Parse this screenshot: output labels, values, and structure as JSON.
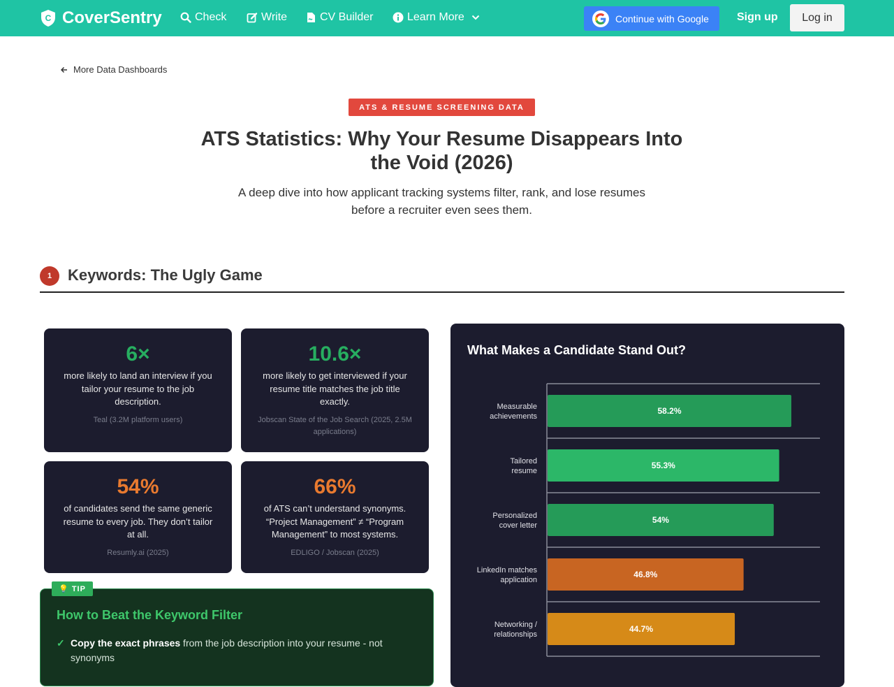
{
  "nav": {
    "brand": "CoverSentry",
    "links": [
      {
        "label": "Check",
        "icon": "search-icon"
      },
      {
        "label": "Write",
        "icon": "edit-icon"
      },
      {
        "label": "CV Builder",
        "icon": "file-signature-icon"
      },
      {
        "label": "Learn More",
        "icon": "info-circle-icon"
      }
    ],
    "google_label": "Continue with Google",
    "signup_label": "Sign up",
    "login_label": "Log in"
  },
  "header": {
    "back_label": "More Data Dashboards",
    "badge": "ATS & RESUME SCREENING DATA",
    "title": "ATS Statistics: Why Your Resume Disappears Into the Void (2026)",
    "subtitle": "A deep dive into how applicant tracking systems filter, rank, and lose resumes before a recruiter even sees them."
  },
  "section": {
    "number": "1",
    "title": "Keywords: The Ugly Game"
  },
  "stats": [
    {
      "value": "6×",
      "desc": "more likely to land an interview if you tailor your resume to the job description.",
      "source": "Teal (3.2M platform users)",
      "color": "#27ae60"
    },
    {
      "value": "10.6×",
      "desc": "more likely to get interviewed if your resume title matches the job title exactly.",
      "source": "Jobscan State of the Job Search (2025, 2.5M applications)",
      "color": "#27ae60"
    },
    {
      "value": "54%",
      "desc": "of candidates send the same generic resume to every job. They don’t tailor at all.",
      "source": "Resumly.ai (2025)",
      "color": "#e97a2f"
    },
    {
      "value": "66%",
      "desc": "of ATS can’t understand synonyms. “Project Management” ≠ “Program Management” to most systems.",
      "source": "EDLIGO / Jobscan (2025)",
      "color": "#e97a2f"
    }
  ],
  "tip": {
    "tag": "💡 TIP",
    "title": "How to Beat the Keyword Filter",
    "items": [
      {
        "check": "✓",
        "bold": "Copy the exact phrases",
        "rest": " from the job description into your resume - not synonyms"
      }
    ]
  },
  "chart_data": {
    "type": "bar",
    "orientation": "horizontal",
    "title": "What Makes a Candidate Stand Out?",
    "categories": [
      "Measurable achievements",
      "Tailored resume",
      "Personalized cover letter",
      "LinkedIn matches application",
      "Networking / relationships"
    ],
    "category_lines": [
      [
        "Measurable",
        "achievements"
      ],
      [
        "Tailored",
        "resume"
      ],
      [
        "Personalized",
        "cover letter"
      ],
      [
        "LinkedIn matches",
        "application"
      ],
      [
        "Networking /",
        "relationships"
      ]
    ],
    "values": [
      58.2,
      55.3,
      54,
      46.8,
      44.7
    ],
    "labels": [
      "58.2%",
      "55.3%",
      "54%",
      "46.8%",
      "44.7%"
    ],
    "colors": [
      "#259b58",
      "#2cb768",
      "#259b58",
      "#c86522",
      "#d68a18"
    ],
    "xlim": [
      0,
      65
    ],
    "grid": true
  }
}
